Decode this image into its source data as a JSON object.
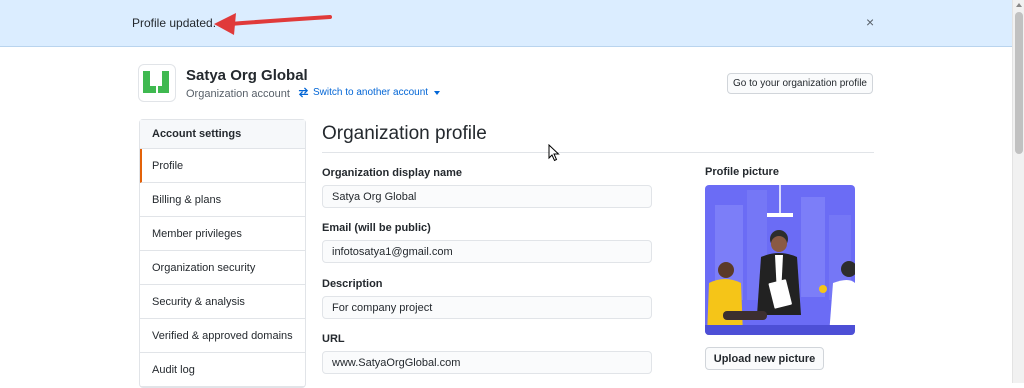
{
  "flash": {
    "message": "Profile updated.",
    "close_glyph": "×"
  },
  "org": {
    "name": "Satya Org Global",
    "type": "Organization account",
    "switch_label": "Switch to another account",
    "profile_button": "Go to your organization profile"
  },
  "sidebar": {
    "heading": "Account settings",
    "items": [
      {
        "label": "Profile",
        "selected": true
      },
      {
        "label": "Billing & plans"
      },
      {
        "label": "Member privileges"
      },
      {
        "label": "Organization security"
      },
      {
        "label": "Security & analysis"
      },
      {
        "label": "Verified & approved domains"
      },
      {
        "label": "Audit log"
      }
    ]
  },
  "main": {
    "title": "Organization profile",
    "fields": {
      "display_name": {
        "label": "Organization display name",
        "value": "Satya Org Global"
      },
      "email": {
        "label": "Email (will be public)",
        "value": "infotosatya1@gmail.com"
      },
      "description": {
        "label": "Description",
        "value": "For company project"
      },
      "url": {
        "label": "URL",
        "value": "www.SatyaOrgGlobal.com"
      }
    },
    "picture": {
      "label": "Profile picture",
      "upload_button": "Upload new picture"
    }
  },
  "icons": {
    "close": "close-icon",
    "switch": "arrows-switch-icon",
    "caret": "caret-down-icon",
    "annotation": "red-arrow-icon",
    "cursor": "mouse-cursor-icon"
  },
  "colors": {
    "accent": "#0366d6",
    "flash_bg": "#dbedff",
    "selected_marker": "#e36209",
    "annotation": "#e03a3a",
    "picture_bg": "#6b6cf5"
  }
}
